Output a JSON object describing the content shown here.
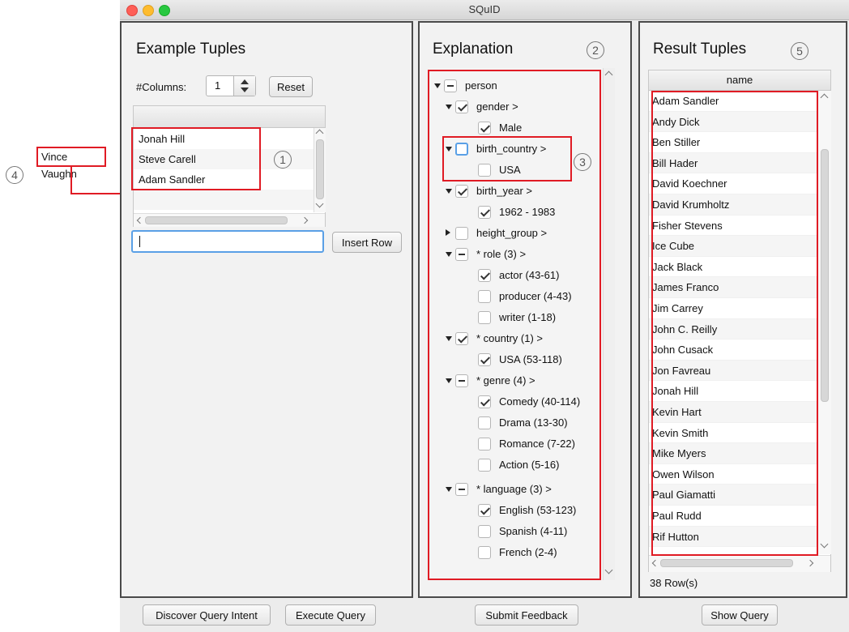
{
  "window": {
    "title": "SQuID"
  },
  "annotations": {
    "vince": "Vince Vaughn",
    "n1": "1",
    "n2": "2",
    "n3": "3",
    "n4": "4",
    "n5": "5"
  },
  "example_panel": {
    "title": "Example Tuples",
    "columns_label": "#Columns:",
    "columns_value": "1",
    "reset_label": "Reset",
    "rows": [
      "Jonah Hill",
      "Steve Carell",
      "Adam Sandler"
    ],
    "input_value": "",
    "insert_label": "Insert Row"
  },
  "explanation_panel": {
    "title": "Explanation",
    "tree": [
      {
        "label": "person",
        "state": "indet"
      },
      {
        "label": "gender  >",
        "state": "checked"
      },
      {
        "label": "Male",
        "state": "checked"
      },
      {
        "label": "birth_country  >",
        "state": "focus"
      },
      {
        "label": "USA",
        "state": "unchecked"
      },
      {
        "label": "birth_year  >",
        "state": "checked"
      },
      {
        "label": "1962 - 1983",
        "state": "checked"
      },
      {
        "label": "height_group  >",
        "state": "unchecked"
      },
      {
        "label": "* role (3) >",
        "state": "indet"
      },
      {
        "label": "actor (43-61)",
        "state": "checked"
      },
      {
        "label": "producer (4-43)",
        "state": "unchecked"
      },
      {
        "label": "writer (1-18)",
        "state": "unchecked"
      },
      {
        "label": "* country (1) >",
        "state": "checked"
      },
      {
        "label": "USA (53-118)",
        "state": "checked"
      },
      {
        "label": "* genre (4)  >",
        "state": "indet"
      },
      {
        "label": "Comedy (40-114)",
        "state": "checked"
      },
      {
        "label": "Drama (13-30)",
        "state": "unchecked"
      },
      {
        "label": "Romance (7-22)",
        "state": "unchecked"
      },
      {
        "label": "Action (5-16)",
        "state": "unchecked"
      },
      {
        "label": "* language (3)  >",
        "state": "indet"
      },
      {
        "label": "English (53-123)",
        "state": "checked"
      },
      {
        "label": "Spanish (4-11)",
        "state": "unchecked"
      },
      {
        "label": "French (2-4)",
        "state": "unchecked"
      }
    ]
  },
  "result_panel": {
    "title": "Result Tuples",
    "column_header": "name",
    "rows": [
      "Adam Sandler",
      "Andy Dick",
      "Ben Stiller",
      "Bill Hader",
      "David Koechner",
      "David Krumholtz",
      "Fisher Stevens",
      "Ice Cube",
      "Jack Black",
      "James Franco",
      "Jim Carrey",
      "John C. Reilly",
      "John Cusack",
      "Jon Favreau",
      "Jonah Hill",
      "Kevin Hart",
      "Kevin Smith",
      "Mike Myers",
      "Owen Wilson",
      "Paul Giamatti",
      "Paul Rudd",
      "Rif Hutton"
    ],
    "row_count": "38 Row(s)"
  },
  "footer": {
    "discover": "Discover Query Intent",
    "execute": "Execute Query",
    "submit": "Submit Feedback",
    "show": "Show Query"
  },
  "colors": {
    "highlight": "#e01b24",
    "focus": "#5aa0e6"
  }
}
